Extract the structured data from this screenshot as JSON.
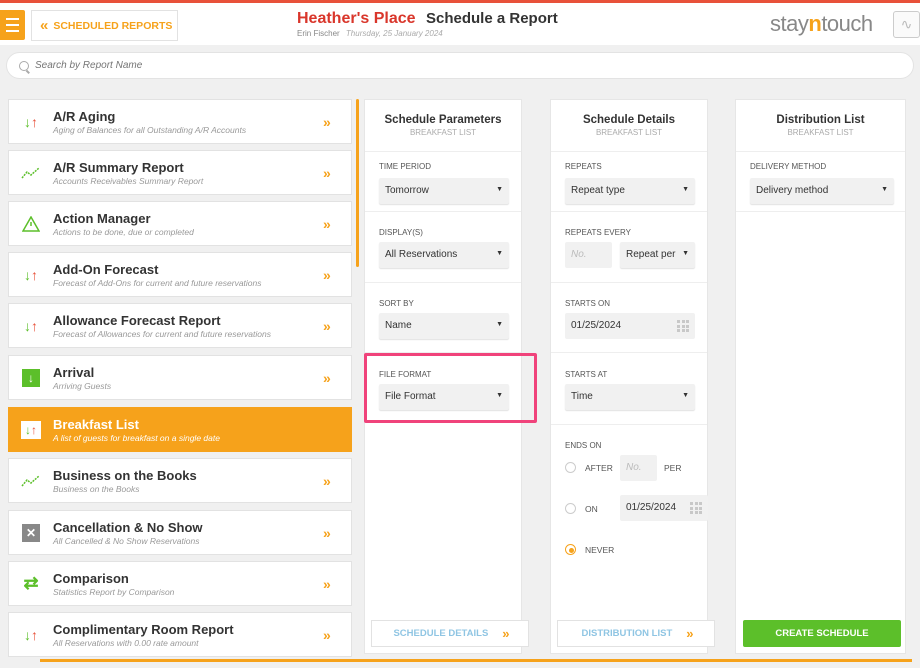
{
  "header": {
    "back_label": "SCHEDULED REPORTS",
    "hotel_name": "Heather's Place",
    "page_title": "Schedule a Report",
    "user_name": "Erin Fischer",
    "date": "Thursday, 25 January 2024",
    "logo_a": "stay",
    "logo_n": "n",
    "logo_b": "touch"
  },
  "search": {
    "placeholder": "Search by Report Name"
  },
  "reports": [
    {
      "name": "A/R Aging",
      "desc": "Aging of Balances for all Outstanding A/R Accounts",
      "icon": "arrows-down-up-icon"
    },
    {
      "name": "A/R Summary Report",
      "desc": "Accounts Receivables Summary Report",
      "icon": "trend-chart-icon"
    },
    {
      "name": "Action Manager",
      "desc": "Actions to be done, due or completed",
      "icon": "warning-icon"
    },
    {
      "name": "Add-On Forecast",
      "desc": "Forecast of Add-Ons for current and future reservations",
      "icon": "arrows-down-up-icon"
    },
    {
      "name": "Allowance Forecast Report",
      "desc": "Forecast of Allowances for current and future reservations",
      "icon": "arrows-down-up-icon"
    },
    {
      "name": "Arrival",
      "desc": "Arriving Guests",
      "icon": "arrival-icon"
    },
    {
      "name": "Breakfast List",
      "desc": "A list of guests for breakfast on a single date",
      "icon": "arrows-down-up-icon",
      "active": true
    },
    {
      "name": "Business on the Books",
      "desc": "Business on the Books",
      "icon": "trend-chart-icon"
    },
    {
      "name": "Cancellation & No Show",
      "desc": "All Cancelled & No Show Reservations",
      "icon": "cancel-icon"
    },
    {
      "name": "Comparison",
      "desc": "Statistics Report by Comparison",
      "icon": "swap-icon"
    },
    {
      "name": "Complimentary Room Report",
      "desc": "All Reservations with 0.00 rate amount",
      "icon": "arrows-down-up-icon"
    }
  ],
  "params": {
    "title": "Schedule Parameters",
    "subtitle": "BREAKFAST LIST",
    "time_period_label": "TIME PERIOD",
    "time_period_value": "Tomorrow",
    "displays_label": "DISPLAY(S)",
    "displays_value": "All Reservations",
    "sort_label": "SORT BY",
    "sort_value": "Name",
    "file_format_label": "FILE FORMAT",
    "file_format_value": "File Format",
    "footer": "SCHEDULE DETAILS"
  },
  "details": {
    "title": "Schedule Details",
    "subtitle": "BREAKFAST LIST",
    "repeats_label": "REPEATS",
    "repeats_value": "Repeat type",
    "repeats_every_label": "REPEATS EVERY",
    "no_placeholder": "No.",
    "repeat_per": "Repeat per",
    "starts_on_label": "STARTS ON",
    "starts_on_value": "01/25/2024",
    "starts_at_label": "STARTS AT",
    "starts_at_value": "Time",
    "ends_on_label": "ENDS ON",
    "after_label": "AFTER",
    "per_label": "PER",
    "on_label": "ON",
    "on_date": "01/25/2024",
    "never_label": "NEVER",
    "footer": "DISTRIBUTION LIST"
  },
  "distribution": {
    "title": "Distribution List",
    "subtitle": "BREAKFAST LIST",
    "method_label": "DELIVERY METHOD",
    "method_value": "Delivery method",
    "create_button": "CREATE SCHEDULE"
  },
  "colors": {
    "accent": "#f6a21b",
    "hotel": "#d9362b",
    "highlight": "#f0437b",
    "create": "#5cbf2a"
  }
}
